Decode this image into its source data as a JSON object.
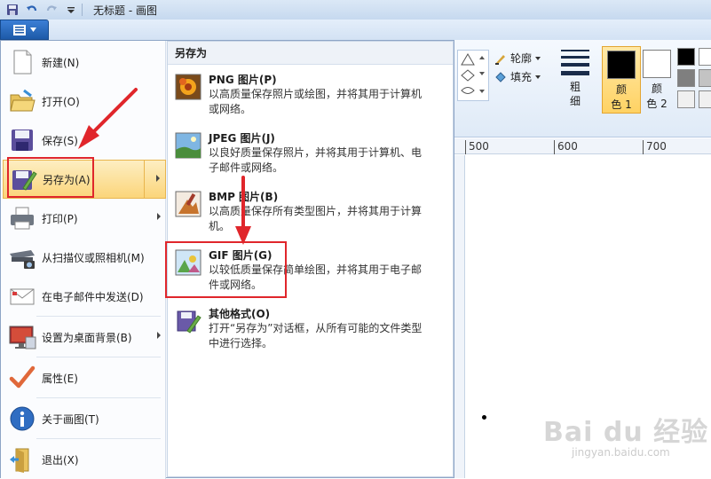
{
  "window": {
    "title": "无标题 - 画图"
  },
  "quick_access": [
    "save-icon",
    "undo-icon",
    "redo-icon",
    "customize-icon"
  ],
  "ribbon": {
    "outline_label": "轮廓",
    "fill_label": "填充",
    "size_label_1": "粗",
    "size_label_2": "细",
    "color1_label_1": "颜",
    "color1_label_2": "色 1",
    "color2_label_1": "颜",
    "color2_label_2": "色 2",
    "color1_value": "#000000",
    "color2_value": "#ffffff",
    "palette": [
      "#000000",
      "#ffffff",
      "#7f7f7f",
      "#c3c3c3",
      "#c3c3c3",
      "#c3c3c3"
    ]
  },
  "ruler": {
    "ticks": [
      "500",
      "600",
      "700"
    ]
  },
  "app_menu": {
    "items": [
      {
        "label": "新建(N)",
        "icon": "new-file-icon"
      },
      {
        "label": "打开(O)",
        "icon": "open-folder-icon"
      },
      {
        "label": "保存(S)",
        "icon": "save-icon"
      },
      {
        "label": "另存为(A)",
        "icon": "save-as-icon"
      },
      {
        "label": "打印(P)",
        "icon": "printer-icon"
      },
      {
        "label": "从扫描仪或照相机(M)",
        "icon": "scanner-icon"
      },
      {
        "label": "在电子邮件中发送(D)",
        "icon": "email-icon"
      },
      {
        "label": "设置为桌面背景(B)",
        "icon": "desktop-background-icon"
      },
      {
        "label": "属性(E)",
        "icon": "checkmark-icon"
      },
      {
        "label": "关于画图(T)",
        "icon": "info-icon"
      },
      {
        "label": "退出(X)",
        "icon": "exit-icon"
      }
    ]
  },
  "save_as_submenu": {
    "header": "另存为",
    "items": [
      {
        "title": "PNG 图片(P)",
        "desc": "以高质量保存照片或绘图，并将其用于计算机或网络。",
        "icon": "png-image-icon"
      },
      {
        "title": "JPEG 图片(J)",
        "desc": "以良好质量保存照片，并将其用于计算机、电子邮件或网络。",
        "icon": "jpeg-image-icon"
      },
      {
        "title": "BMP 图片(B)",
        "desc": "以高质量保存所有类型图片，并将其用于计算机。",
        "icon": "bmp-image-icon"
      },
      {
        "title": "GIF 图片(G)",
        "desc": "以较低质量保存简单绘图，并将其用于电子邮件或网络。",
        "icon": "gif-image-icon"
      },
      {
        "title": "其他格式(O)",
        "desc": "打开“另存为”对话框，从所有可能的文件类型中进行选择。",
        "icon": "other-formats-icon"
      }
    ]
  },
  "annotation_colors": {
    "highlight": "#e0262b"
  },
  "watermark": {
    "main": "Bai du 经验",
    "sub": "jingyan.baidu.com"
  }
}
